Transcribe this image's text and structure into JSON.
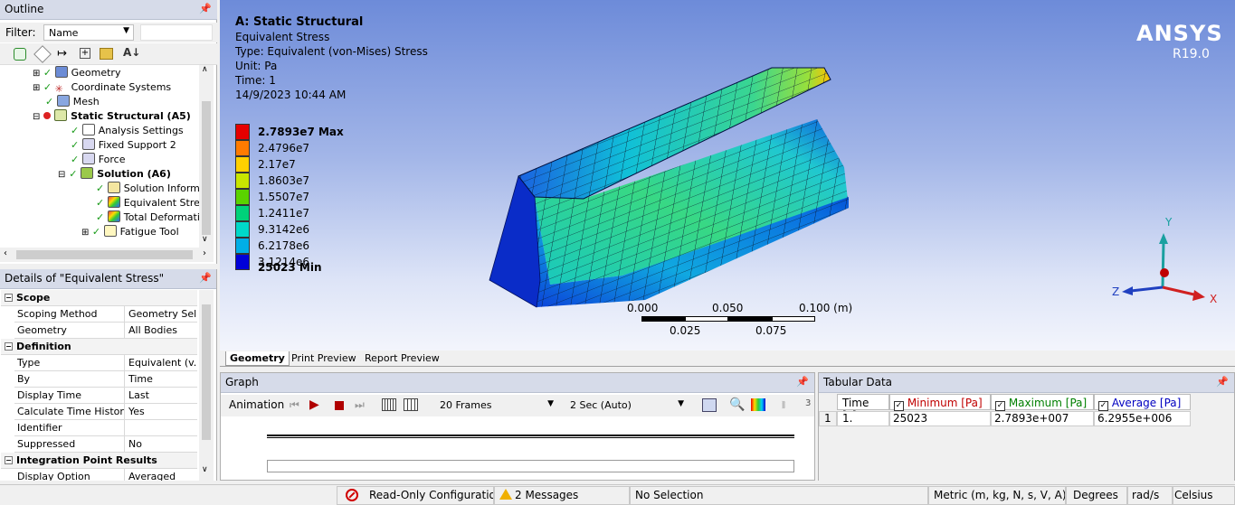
{
  "outline": {
    "title": "Outline",
    "pin": "⸸",
    "filter_label": "Filter:",
    "filter_value": "Name",
    "filter_text": "",
    "tree": [
      {
        "label": "Geometry",
        "bold": false
      },
      {
        "label": "Coordinate Systems",
        "bold": false
      },
      {
        "label": "Mesh",
        "bold": false
      },
      {
        "label": "Static Structural (A5)",
        "bold": true
      },
      {
        "label": "Analysis Settings",
        "bold": false
      },
      {
        "label": "Fixed Support 2",
        "bold": false
      },
      {
        "label": "Force",
        "bold": false
      },
      {
        "label": "Solution (A6)",
        "bold": true
      },
      {
        "label": "Solution Informa",
        "bold": false
      },
      {
        "label": "Equivalent Stress",
        "bold": false
      },
      {
        "label": "Total Deformatio",
        "bold": false
      },
      {
        "label": "Fatigue Tool",
        "bold": false
      }
    ]
  },
  "details": {
    "title": "Details of \"Equivalent Stress\"",
    "sections": {
      "scope": "Scope",
      "definition": "Definition",
      "integration": "Integration Point Results"
    },
    "rows": {
      "scoping_method": {
        "k": "Scoping Method",
        "v": "Geometry Sel..."
      },
      "geometry": {
        "k": "Geometry",
        "v": "All Bodies"
      },
      "type": {
        "k": "Type",
        "v": "Equivalent (v..."
      },
      "by": {
        "k": "By",
        "v": "Time"
      },
      "display_time": {
        "k": "Display Time",
        "v": "Last"
      },
      "calc_time_history": {
        "k": "Calculate Time History",
        "v": "Yes"
      },
      "identifier": {
        "k": "Identifier",
        "v": ""
      },
      "suppressed": {
        "k": "Suppressed",
        "v": "No"
      },
      "display_option": {
        "k": "Display Option",
        "v": "Averaged"
      }
    }
  },
  "viewport": {
    "title": "A: Static Structural",
    "result": "Equivalent Stress",
    "type": "Type: Equivalent (von-Mises) Stress",
    "unit": "Unit: Pa",
    "time": "Time: 1",
    "date": "14/9/2023 10:44 AM",
    "brand": "ANSYS",
    "version": "R19.0",
    "legend": [
      {
        "label": "2.7893e7 Max",
        "color": "#e60000",
        "bold": true
      },
      {
        "label": "2.4796e7",
        "color": "#ff7b00",
        "bold": false
      },
      {
        "label": "2.17e7",
        "color": "#ffd000",
        "bold": false
      },
      {
        "label": "1.8603e7",
        "color": "#c8e600",
        "bold": false
      },
      {
        "label": "1.5507e7",
        "color": "#5ad300",
        "bold": false
      },
      {
        "label": "1.2411e7",
        "color": "#00d27a",
        "bold": false
      },
      {
        "label": "9.3142e6",
        "color": "#00d8c8",
        "bold": false
      },
      {
        "label": "6.2178e6",
        "color": "#00aee6",
        "bold": false
      },
      {
        "label": "3.1214e6",
        "color": "#0070e6",
        "bold": false
      },
      {
        "label": "25023 Min",
        "color": "#0000d8",
        "bold": true
      }
    ],
    "scale": {
      "t0": "0.000",
      "t1": "0.050",
      "t2": "0.100 (m)",
      "b1": "0.025",
      "b2": "0.075"
    },
    "axes": {
      "y": "Y",
      "z": "Z",
      "x": "X"
    }
  },
  "view_tabs": [
    "Geometry",
    "Print Preview",
    "Report Preview"
  ],
  "graph": {
    "title": "Graph",
    "animation_label": "Animation",
    "frames": "20 Frames",
    "duration": "2 Sec (Auto)",
    "count": "3"
  },
  "tabular": {
    "title": "Tabular Data",
    "headers": {
      "time": "Time [s]",
      "min": "Minimum [Pa]",
      "max": "Maximum [Pa]",
      "avg": "Average [Pa]"
    },
    "row": {
      "idx": "1",
      "time": "1.",
      "min": "25023",
      "max": "2.7893e+007",
      "avg": "6.2955e+006"
    },
    "colors": {
      "min": "#c00000",
      "max": "#008000",
      "avg": "#0000c0"
    }
  },
  "status": {
    "readonly": "Read-Only Configuratio",
    "messages": "2 Messages",
    "selection": "No Selection",
    "units": "Metric (m, kg, N, s, V, A)",
    "angle": "Degrees",
    "rate": "rad/s",
    "temp": "Celsius"
  }
}
